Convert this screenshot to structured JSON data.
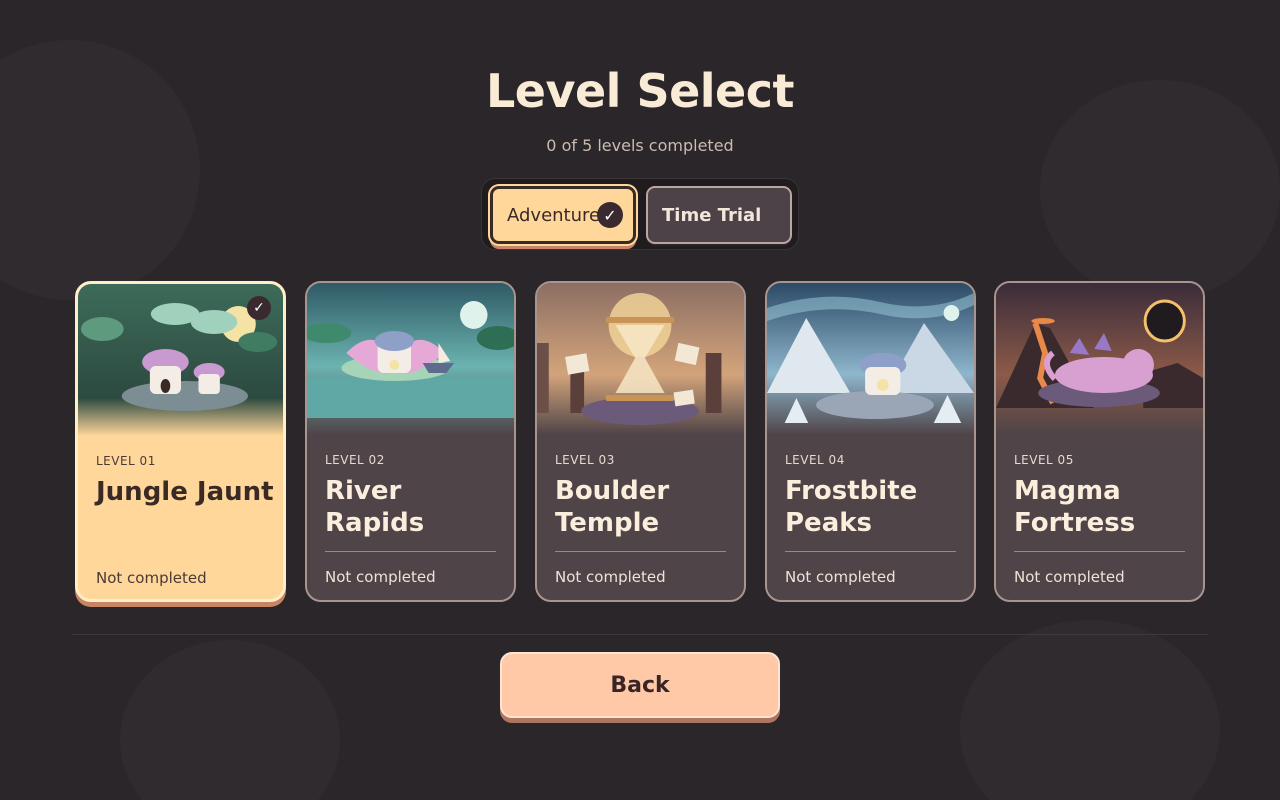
{
  "header": {
    "title": "Level Select",
    "progress_text": "0 of 5 levels completed"
  },
  "modes": {
    "active_label": "Adventure",
    "inactive_label": "Time Trial"
  },
  "levels": [
    {
      "number": "LEVEL 01",
      "name": "Jungle Jaunt",
      "status": "Not completed"
    },
    {
      "number": "LEVEL 02",
      "name": "River Rapids",
      "status": "Not completed"
    },
    {
      "number": "LEVEL 03",
      "name": "Boulder Temple",
      "status": "Not completed"
    },
    {
      "number": "LEVEL 04",
      "name": "Frostbite Peaks",
      "status": "Not completed"
    },
    {
      "number": "LEVEL 05",
      "name": "Magma Fortress",
      "status": "Not completed"
    }
  ],
  "footer": {
    "back_label": "Back"
  },
  "colors": {
    "background": "#2a2629",
    "selected_card": "#ffd79a",
    "card": "#4f4448",
    "back_button": "#ffc9a8"
  },
  "icons": {
    "mode_check": "check-icon",
    "card_check": "check-icon"
  }
}
